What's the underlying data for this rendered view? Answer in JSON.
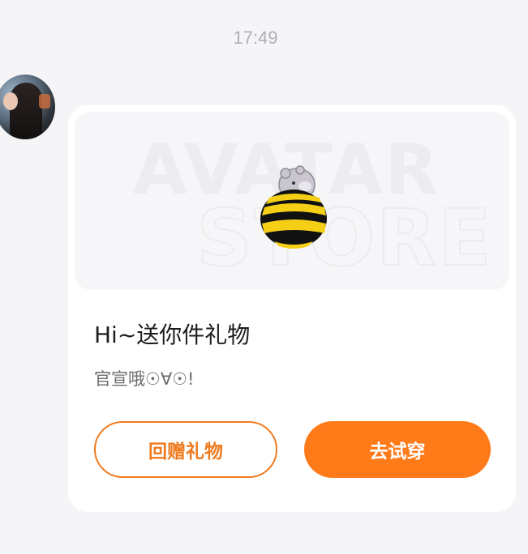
{
  "message": {
    "timestamp": "17:49",
    "sender_avatar_icon": "user-avatar-photo"
  },
  "gift_card": {
    "banner_watermark_line1": "AVATAR",
    "banner_watermark_line2": "STORE",
    "gift_item_icon": "bee-costume-icon",
    "title": "Hi~送你件礼物",
    "subtitle": "官宣哦☉∀☉!",
    "buttons": {
      "return_gift": "回赠礼物",
      "try_on": "去试穿"
    }
  },
  "colors": {
    "accent": "#ff7a18",
    "background": "#f5f5f7",
    "card": "#ffffff"
  }
}
